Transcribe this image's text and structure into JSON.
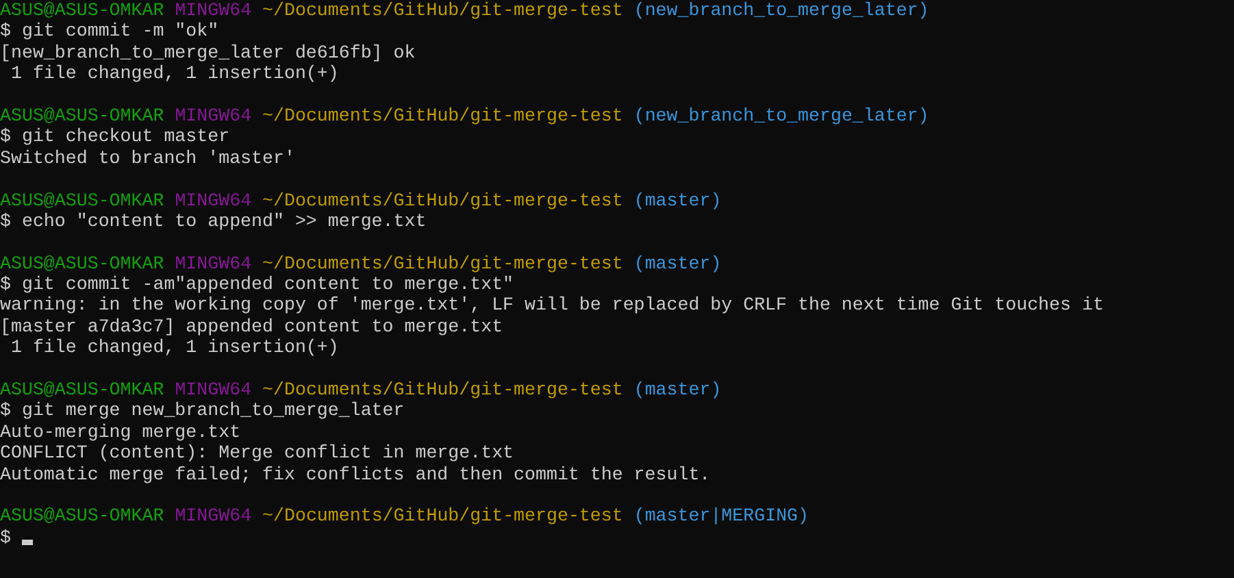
{
  "terminal": {
    "lines": [
      {
        "kind": "prompt",
        "user": "ASUS@ASUS-OMKAR",
        "system": "MINGW64",
        "path": "~/Documents/GitHub/git-merge-test",
        "branch": "(new_branch_to_merge_later)"
      },
      {
        "kind": "command",
        "text": "$ git commit -m \"ok\""
      },
      {
        "kind": "output",
        "text": "[new_branch_to_merge_later de616fb] ok"
      },
      {
        "kind": "output",
        "text": " 1 file changed, 1 insertion(+)"
      },
      {
        "kind": "blank"
      },
      {
        "kind": "prompt",
        "user": "ASUS@ASUS-OMKAR",
        "system": "MINGW64",
        "path": "~/Documents/GitHub/git-merge-test",
        "branch": "(new_branch_to_merge_later)"
      },
      {
        "kind": "command",
        "text": "$ git checkout master"
      },
      {
        "kind": "output",
        "text": "Switched to branch 'master'"
      },
      {
        "kind": "blank"
      },
      {
        "kind": "prompt",
        "user": "ASUS@ASUS-OMKAR",
        "system": "MINGW64",
        "path": "~/Documents/GitHub/git-merge-test",
        "branch": "(master)"
      },
      {
        "kind": "command",
        "text": "$ echo \"content to append\" >> merge.txt"
      },
      {
        "kind": "blank"
      },
      {
        "kind": "prompt",
        "user": "ASUS@ASUS-OMKAR",
        "system": "MINGW64",
        "path": "~/Documents/GitHub/git-merge-test",
        "branch": "(master)"
      },
      {
        "kind": "command",
        "text": "$ git commit -am\"appended content to merge.txt\""
      },
      {
        "kind": "output",
        "text": "warning: in the working copy of 'merge.txt', LF will be replaced by CRLF the next time Git touches it"
      },
      {
        "kind": "output",
        "text": "[master a7da3c7] appended content to merge.txt"
      },
      {
        "kind": "output",
        "text": " 1 file changed, 1 insertion(+)"
      },
      {
        "kind": "blank"
      },
      {
        "kind": "prompt",
        "user": "ASUS@ASUS-OMKAR",
        "system": "MINGW64",
        "path": "~/Documents/GitHub/git-merge-test",
        "branch": "(master)"
      },
      {
        "kind": "command",
        "text": "$ git merge new_branch_to_merge_later"
      },
      {
        "kind": "output",
        "text": "Auto-merging merge.txt"
      },
      {
        "kind": "output",
        "text": "CONFLICT (content): Merge conflict in merge.txt"
      },
      {
        "kind": "output",
        "text": "Automatic merge failed; fix conflicts and then commit the result."
      },
      {
        "kind": "blank"
      },
      {
        "kind": "prompt",
        "user": "ASUS@ASUS-OMKAR",
        "system": "MINGW64",
        "path": "~/Documents/GitHub/git-merge-test",
        "branch": "(master|MERGING)"
      },
      {
        "kind": "input",
        "text": "$",
        "cursor": true
      }
    ]
  }
}
